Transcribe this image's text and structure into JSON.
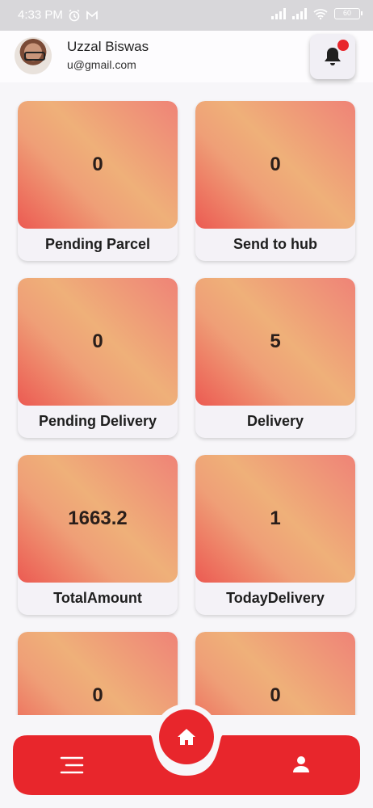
{
  "status": {
    "time": "4:33 PM",
    "battery": "60"
  },
  "profile": {
    "name": "Uzzal Biswas",
    "email": "u@gmail.com"
  },
  "cards": [
    {
      "value": "0",
      "label": "Pending Parcel"
    },
    {
      "value": "0",
      "label": "Send to hub"
    },
    {
      "value": "0",
      "label": "Pending Delivery"
    },
    {
      "value": "5",
      "label": "Delivery"
    },
    {
      "value": "1663.2",
      "label": "TotalAmount"
    },
    {
      "value": "1",
      "label": "TodayDelivery"
    },
    {
      "value": "0",
      "label": ""
    },
    {
      "value": "0",
      "label": ""
    }
  ],
  "icons": {
    "notification": "bell-icon",
    "home": "home-icon",
    "menu": "menu-icon",
    "profile": "person-icon"
  },
  "colors": {
    "accent": "#e8262c",
    "card_gradient_start": "#ef8377",
    "card_gradient_end": "#ec5a52"
  }
}
